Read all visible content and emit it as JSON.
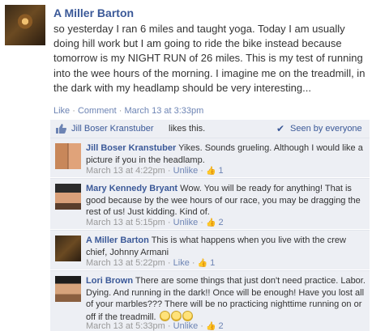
{
  "post": {
    "author": "A Miller Barton",
    "message": "so yesterday I ran 6 miles and taught yoga. Today I am usually doing hill work but I am going to ride the bike instead because tomorrow is my NIGHT RUN of 26 miles. This is my test of running into the wee hours of the morning. I imagine me on the treadmill, in the dark with my headlamp should be very interesting...",
    "like_link": "Like",
    "comment_link": "Comment",
    "timestamp": "March 13 at 3:33pm",
    "separator": "·"
  },
  "likes": {
    "liker": "Jill Boser Kranstuber",
    "text": "likes this.",
    "seen": "Seen by everyone",
    "thumb_icon": "thumbs-up-icon",
    "check_icon": "checkmark-icon"
  },
  "comments": [
    {
      "name": "Jill Boser Kranstuber",
      "text": "Yikes. Sounds grueling. Although I would like a picture if you in the headlamp.",
      "time": "March 13 at 4:22pm",
      "action": "Unlike",
      "likes": "1"
    },
    {
      "name": "Mary Kennedy Bryant",
      "text": "Wow. You will be ready for anything! That is good because by the wee hours of our race, you may be dragging the rest of us! Just kidding. Kind of.",
      "time": "March 13 at 5:15pm",
      "action": "Unlike",
      "likes": "2"
    },
    {
      "name": "A Miller Barton",
      "text": "This is what happens when you live with the crew chief, Johnny Armani",
      "time": "March 13 at 5:22pm",
      "action": "Like",
      "likes": "1"
    },
    {
      "name": "Lori Brown",
      "text": "There are some things that just don't need practice. Labor. Dying. And running in the dark!! Once will be enough! Have you lost all of your marbles??? There will be no practicing nighttime running on or off if the treadmill.",
      "time": "March 13 at 5:33pm",
      "action": "Unlike",
      "likes": "2"
    }
  ],
  "colors": {
    "link": "#3b5998",
    "meta": "#999999",
    "comment_bg": "#edeff4"
  }
}
